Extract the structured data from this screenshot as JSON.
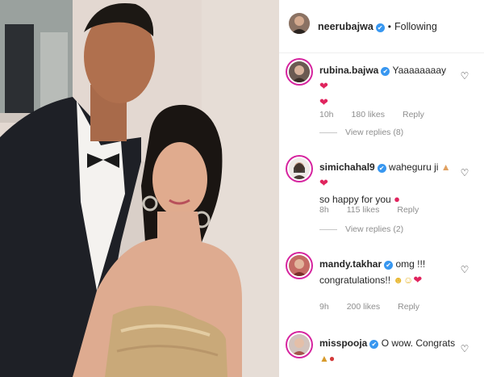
{
  "post": {
    "author": "neerubajwa",
    "follow_status": "Following",
    "separator": "•"
  },
  "comments": [
    {
      "username": "rubina.bajwa",
      "text": "Yaaaaaaaay",
      "emoji_line2": "❤",
      "time": "10h",
      "likes": "180 likes",
      "reply": "Reply",
      "view_replies": "View replies (8)"
    },
    {
      "username": "simichahal9",
      "text": "waheguru ji",
      "text_line2": "so happy for you",
      "time": "8h",
      "likes": "115 likes",
      "reply": "Reply",
      "view_replies": "View replies (2)"
    },
    {
      "username": "mandy.takhar",
      "text": "omg !!!",
      "text_line2": "congratulations!!",
      "time": "9h",
      "likes": "200 likes",
      "reply": "Reply"
    },
    {
      "username": "misspooja",
      "text": "O wow. Congrats"
    }
  ],
  "icons": {
    "verified": "✔",
    "heart_outline": "♡",
    "heart_emoji": "❤"
  },
  "colors": {
    "accent_blue": "#3897f0",
    "meta_gray": "#8e8e8e",
    "story_ring": "#d6249f"
  }
}
